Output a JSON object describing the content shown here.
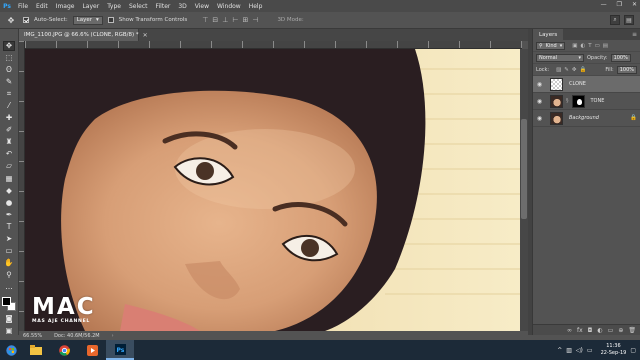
{
  "app": {
    "logo": "Ps"
  },
  "menubar": {
    "items": [
      "File",
      "Edit",
      "Image",
      "Layer",
      "Type",
      "Select",
      "Filter",
      "3D",
      "View",
      "Window",
      "Help"
    ]
  },
  "window_controls": {
    "minimize": "—",
    "restore": "❐",
    "close": "✕"
  },
  "options_bar": {
    "auto_select_label": "Auto-Select:",
    "auto_select_checked": true,
    "auto_select_target": "Layer",
    "show_transform_label": "Show Transform Controls",
    "show_transform_checked": false,
    "mode_3d_label": "3D Mode:"
  },
  "document": {
    "tab_title": "IMG_1100.JPG @ 66.6% (CLONE, RGB/8) *",
    "close": "✕"
  },
  "status": {
    "zoom": "66.55%",
    "doc": "Doc: 40.6M/56.2M",
    "arrow": "›"
  },
  "watermark": {
    "big": "MAC",
    "small": "MAS AJE CHANNEL"
  },
  "layers_panel": {
    "tab": "Layers",
    "filter_kind": "Kind",
    "blend_mode": "Normal",
    "opacity_label": "Opacity:",
    "opacity_value": "100%",
    "lock_label": "Lock:",
    "fill_label": "Fill:",
    "fill_value": "100%",
    "layers": [
      {
        "name": "CLONE",
        "selected": true,
        "thumb": "transparent"
      },
      {
        "name": "TONE",
        "selected": false,
        "thumb": "adjustment"
      },
      {
        "name": "Background",
        "selected": false,
        "thumb": "photo",
        "locked": true
      }
    ]
  },
  "taskbar": {
    "time": "11:36",
    "date": "22-Sep-19"
  },
  "colors": {
    "accent": "#31a8ff",
    "hijab": "#2b1f22",
    "skin": "#d9a27c",
    "background": "#f0e0b4"
  }
}
